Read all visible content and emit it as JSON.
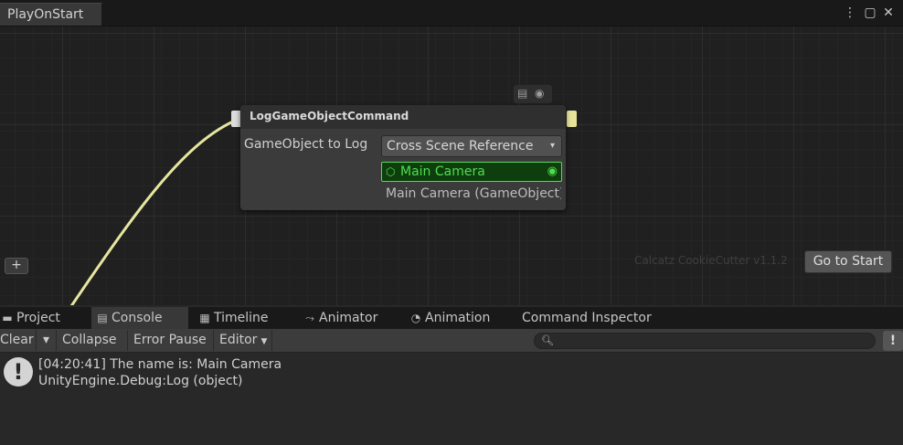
{
  "window": {
    "tab_title": "PlayOnStart",
    "menu_icon": "⋮",
    "maximize_icon": "▢",
    "close_icon": "✕"
  },
  "node": {
    "title": "LogGameObjectCommand",
    "field_label": "GameObject to Log",
    "reference_type": "Cross Scene Reference",
    "object_value": "Main Camera",
    "object_subtext": "Main Camera (GameObject)",
    "caret": "▾"
  },
  "graph": {
    "add_label": "+",
    "version": "Calcatz CookieCutter v1.1.2",
    "goto_label": "Go to Start"
  },
  "bottom_tabs": [
    {
      "label": "Project",
      "icon": "folder-icon"
    },
    {
      "label": "Console",
      "icon": "console-icon",
      "active": true
    },
    {
      "label": "Timeline",
      "icon": "timeline-icon"
    },
    {
      "label": "Animator",
      "icon": "animator-icon"
    },
    {
      "label": "Animation",
      "icon": "clock-icon"
    },
    {
      "label": "Command Inspector",
      "icon": ""
    }
  ],
  "console_toolbar": {
    "clear": "Clear",
    "collapse": "Collapse",
    "error_pause": "Error Pause",
    "editor": "Editor",
    "search_placeholder": ""
  },
  "console_entries": [
    {
      "line1": "[04:20:41] The name is: Main Camera",
      "line2": "UnityEngine.Debug:Log (object)"
    }
  ],
  "colors": {
    "connection": "#e6e6a0",
    "object_field_border": "#5bd85b",
    "object_field_text": "#4dde4d"
  }
}
